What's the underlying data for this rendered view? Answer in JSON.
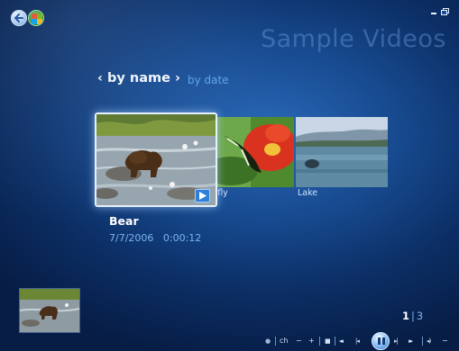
{
  "window": {
    "title": "Sample Videos",
    "minimize_label": "–",
    "restore_label": "restore"
  },
  "sort": {
    "active_label": "by name",
    "other_label": "by date",
    "prev_glyph": "‹",
    "next_glyph": "›"
  },
  "gallery": {
    "items": [
      {
        "title": "Bear",
        "caption": ""
      },
      {
        "title": "Butterfly",
        "caption": "tterfly"
      },
      {
        "title": "Lake",
        "caption": "Lake"
      }
    ]
  },
  "selection": {
    "name": "Bear",
    "date": "7/7/2006",
    "duration": "0:00:12",
    "date_duration": "7/7/2006   0:00:12"
  },
  "pager": {
    "current": "1",
    "total": "3",
    "separator": "|"
  },
  "transport": {
    "record_glyph": "●",
    "channel_label": "ch",
    "ch_minus": "−",
    "ch_plus": "+",
    "stop_glyph": "■",
    "rewind_glyph": "◂◂",
    "skip_back_glyph": "|◂",
    "skip_fwd_glyph": "▸|",
    "ffwd_glyph": "▸▸",
    "volume_glyph": "◂)",
    "vol_minus": "−"
  },
  "icons": {
    "back": "back-arrow-icon",
    "start": "windows-logo-icon",
    "play_badge": "play-icon",
    "pause": "pause-icon"
  },
  "colors": {
    "background_dark": "#071d46",
    "background_mid": "#174a8f",
    "accent_blue": "#5ea6ea",
    "title_faded": "#6ea0e1"
  }
}
